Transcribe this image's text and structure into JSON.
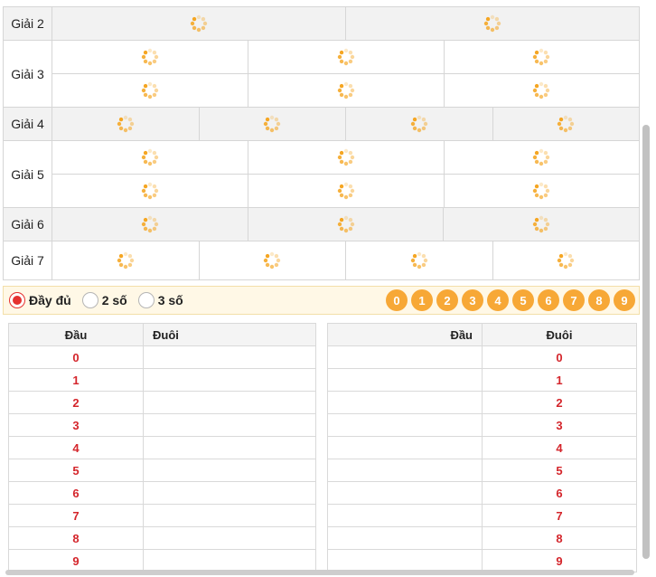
{
  "prizes": [
    {
      "label": "Giải 2",
      "rows": 1,
      "cols": 2
    },
    {
      "label": "Giải 3",
      "rows": 2,
      "cols": 3
    },
    {
      "label": "Giải 4",
      "rows": 1,
      "cols": 4
    },
    {
      "label": "Giải 5",
      "rows": 2,
      "cols": 3
    },
    {
      "label": "Giải 6",
      "rows": 1,
      "cols": 3
    },
    {
      "label": "Giải 7",
      "rows": 1,
      "cols": 4
    }
  ],
  "filter": {
    "options": [
      "Đầy đủ",
      "2 số",
      "3 số"
    ],
    "selected": "Đầy đủ",
    "digits": [
      "0",
      "1",
      "2",
      "3",
      "4",
      "5",
      "6",
      "7",
      "8",
      "9"
    ]
  },
  "left_table": {
    "headers": [
      "Đầu",
      "Đuôi"
    ],
    "rows": [
      "0",
      "1",
      "2",
      "3",
      "4",
      "5",
      "6",
      "7",
      "8",
      "9"
    ]
  },
  "right_table": {
    "headers": [
      "Đầu",
      "Đuôi"
    ],
    "rows": [
      "0",
      "1",
      "2",
      "3",
      "4",
      "5",
      "6",
      "7",
      "8",
      "9"
    ]
  },
  "colors": {
    "accent": "#f7a836",
    "number_red": "#d4252b",
    "radio_active": "#e5312f",
    "spinner": "#f5a623"
  },
  "icons": {
    "loading": "spinner-icon"
  }
}
